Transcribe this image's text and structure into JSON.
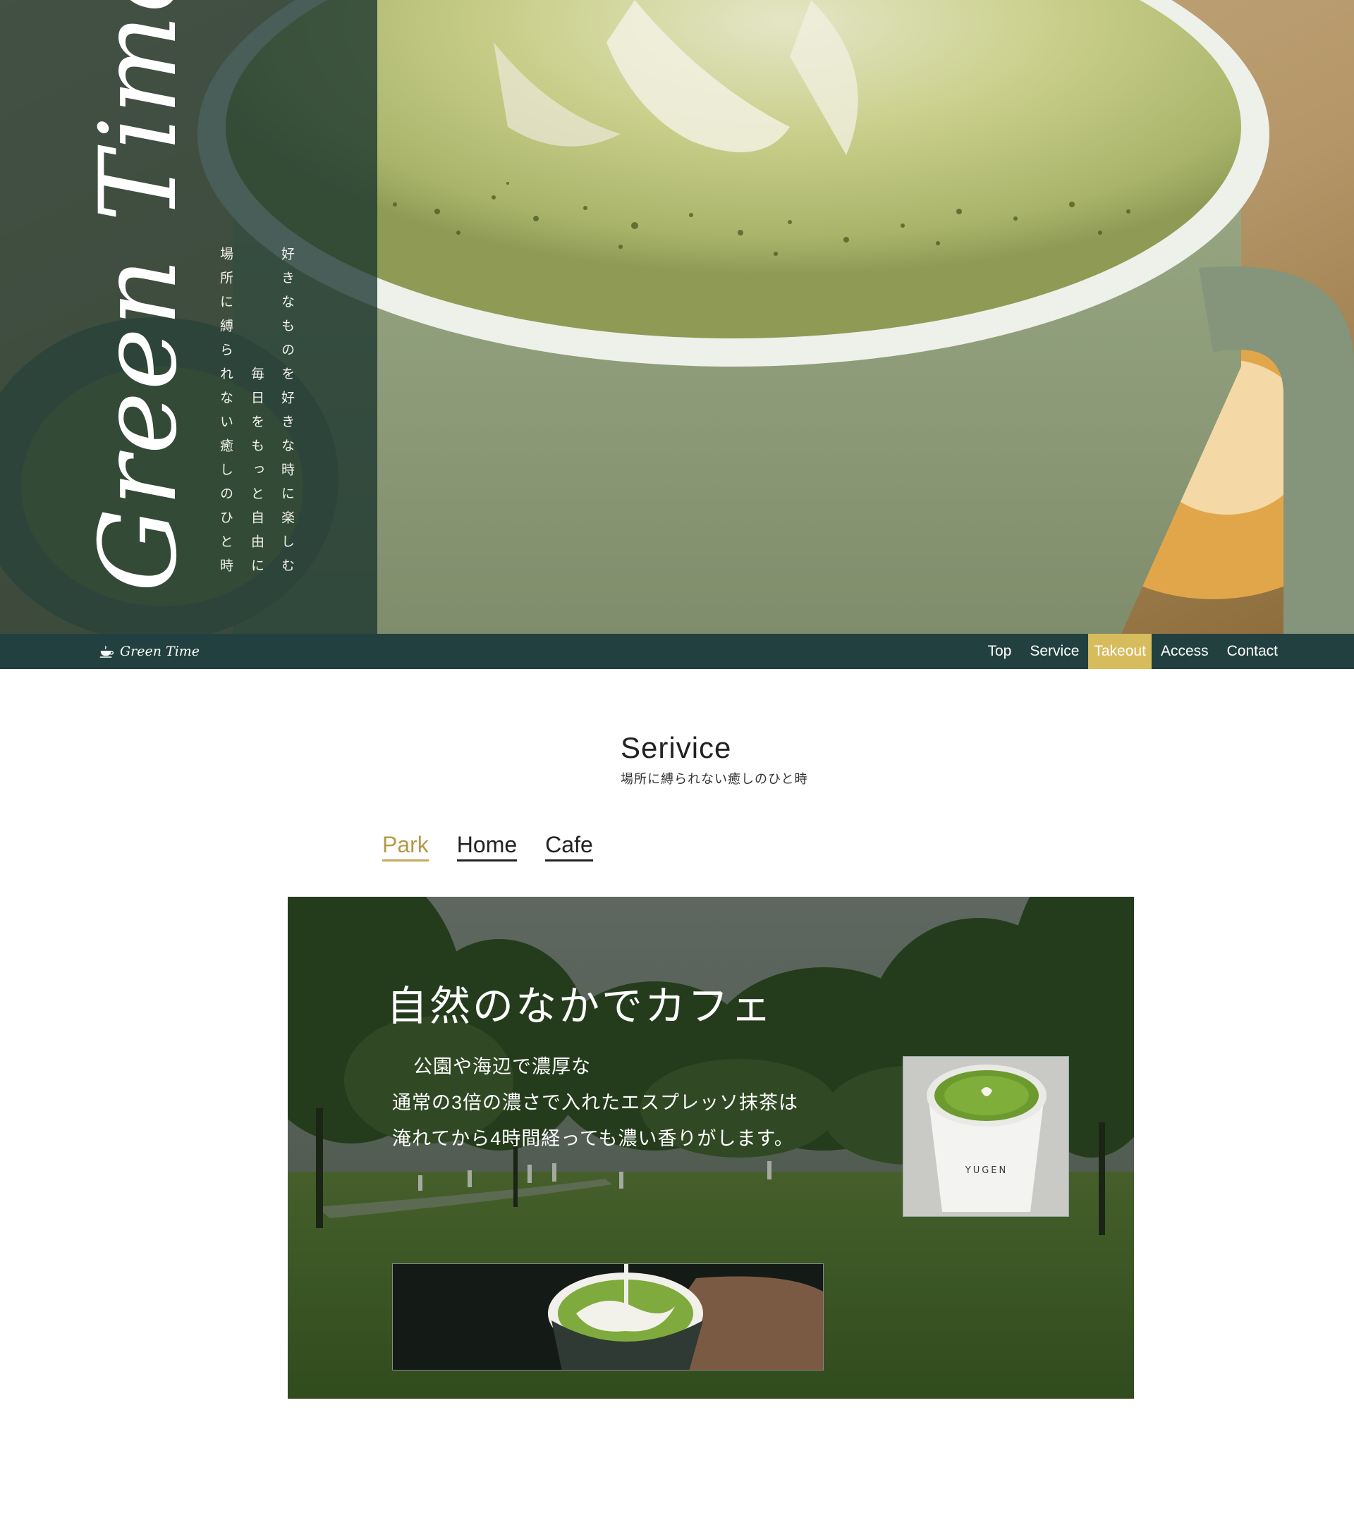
{
  "hero": {
    "title": "Green Time",
    "copy_lines": [
      "好きなものを好きな時に楽しむ",
      "毎日をもっと自由に",
      "場所に縛られない癒しのひと時"
    ]
  },
  "navbar": {
    "brand": "Green Time",
    "items": [
      "Top",
      "Service",
      "Takeout",
      "Access",
      "Contact"
    ],
    "active_item": "Takeout"
  },
  "service": {
    "title": "Serivice",
    "subtitle": "場所に縛られない癒しのひと時",
    "tabs": [
      "Park",
      "Home",
      "Cafe"
    ],
    "active_tab": "Park",
    "panel": {
      "heading": "自然のなかでカフェ",
      "lines": [
        "公園や海辺で濃厚な",
        "通常の3倍の濃さで入れたエスプレッソ抹茶は",
        "淹れてから4時間経っても濃い香りがします。"
      ],
      "cup_logo": "YUGEN"
    }
  },
  "colors": {
    "navbar_bg": "#22403f",
    "nav_active_bg": "#d7bc5e",
    "tab_active": "#b49a48",
    "hero_panel": "#1b342e"
  }
}
